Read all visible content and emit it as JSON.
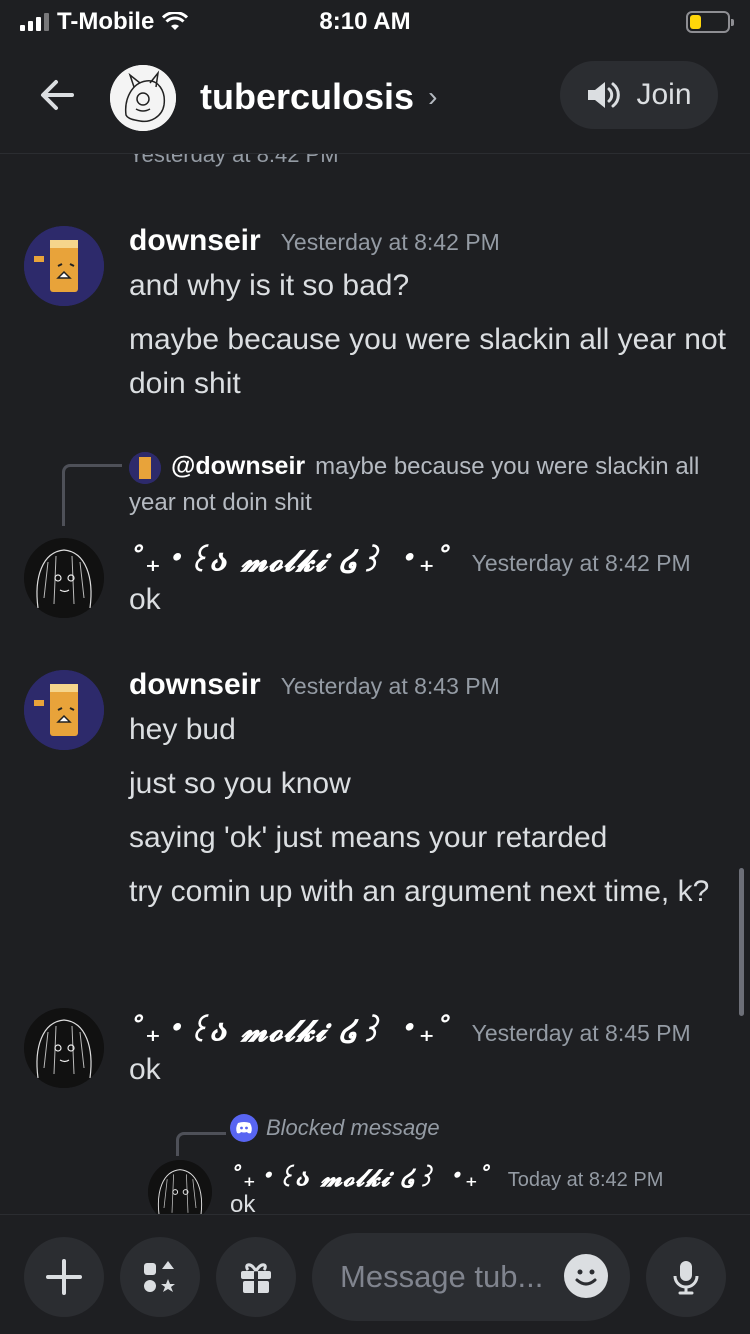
{
  "status_bar": {
    "carrier": "T-Mobile",
    "time": "8:10 AM",
    "battery_level": 0.3
  },
  "header": {
    "channel_name": "tuberculosis",
    "join_label": "Join"
  },
  "partial_timestamp": "Yesterday at 8:42 PM",
  "messages": [
    {
      "author": "downseir",
      "timestamp": "Yesterday at 8:42 PM",
      "lines": [
        "and why is it so bad?",
        "maybe because you were slackin all year not doin shit"
      ]
    },
    {
      "author": "˚₊‧꒰ა 𝓶𝓸𝓵𝓴𝓲 ໒꒱ ‧₊˚",
      "timestamp": "Yesterday at 8:42 PM",
      "lines": [
        "ok"
      ],
      "reply": {
        "author": "@downseir",
        "text": "maybe because you were slackin all year not doin shit"
      }
    },
    {
      "author": "downseir",
      "timestamp": "Yesterday at 8:43 PM",
      "lines": [
        "hey bud",
        "just so you know",
        "saying 'ok' just means your retarded",
        "try comin up with an argument next time, k?"
      ]
    },
    {
      "author": "˚₊‧꒰ა 𝓶𝓸𝓵𝓴𝓲 ໒꒱ ‧₊˚",
      "timestamp": "Yesterday at 8:45 PM",
      "lines": [
        "ok"
      ]
    },
    {
      "author": "˚₊‧꒰ა 𝓶𝓸𝓵𝓴𝓲 ໒꒱ ‧₊˚",
      "timestamp": "Today at 8:42 PM",
      "lines": [
        "ok"
      ],
      "reply_label": "Blocked message"
    }
  ],
  "composer": {
    "placeholder": "Message tub..."
  },
  "icons": [
    "back-arrow-icon",
    "speaker-icon",
    "plus-icon",
    "apps-icon",
    "gift-icon",
    "emoji-icon",
    "microphone-icon",
    "discord-icon"
  ],
  "colors": {
    "background": "#1e1f22",
    "surface": "#2b2d31",
    "text": "#dbdee1",
    "muted": "#949ba4",
    "blurple": "#5865f2"
  }
}
